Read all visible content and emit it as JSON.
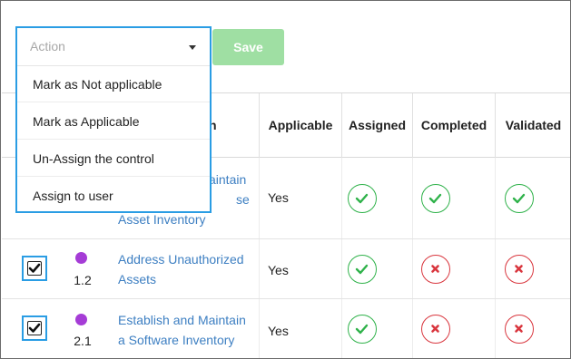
{
  "action_dropdown": {
    "placeholder": "Action",
    "items": [
      {
        "label": "Mark as Not applicable"
      },
      {
        "label": "Mark as Applicable"
      },
      {
        "label": "Un-Assign the control"
      },
      {
        "label": "Assign to user"
      }
    ]
  },
  "toolbar": {
    "save_label": "Save"
  },
  "table": {
    "headers": {
      "name_partial": "n",
      "applicable": "Applicable",
      "assigned": "Assigned",
      "completed": "Completed",
      "validated": "Validated"
    },
    "rows": [
      {
        "id": "",
        "name_lines": [
          "aintain",
          "se",
          "Asset Inventory"
        ],
        "applicable": "Yes",
        "checked": null,
        "assigned": "ok",
        "completed": "ok",
        "validated": "ok"
      },
      {
        "id": "1.2",
        "name_lines": [
          "Address Unauthorized",
          "Assets"
        ],
        "applicable": "Yes",
        "checked": true,
        "assigned": "ok",
        "completed": "no",
        "validated": "no"
      },
      {
        "id": "2.1",
        "name_lines": [
          "Establish and Maintain",
          "a Software Inventory"
        ],
        "applicable": "Yes",
        "checked": true,
        "assigned": "ok",
        "completed": "no",
        "validated": "no"
      }
    ]
  },
  "colors": {
    "highlight": "#2a9de4",
    "link": "#3d7fc2",
    "status_ok": "#2fb24a",
    "status_no": "#d9363e",
    "dot": "#a53cd6",
    "save_bg": "#9fdfa3"
  }
}
